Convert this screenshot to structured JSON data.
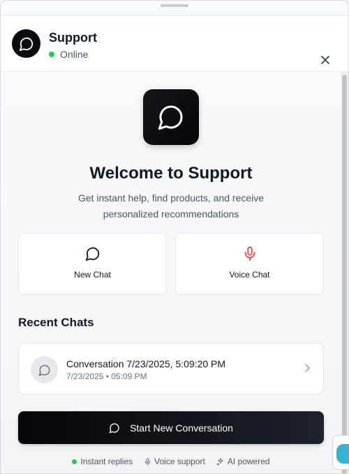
{
  "header": {
    "title": "Support",
    "status": "Online",
    "status_color": "#22c55e"
  },
  "hero": {
    "icon": "chat-bubble-icon",
    "title": "Welcome to Support",
    "subtitle": "Get instant help, find products, and receive personalized recommendations"
  },
  "actions": [
    {
      "label": "New Chat",
      "icon": "chat-bubble-icon",
      "color": "#111827"
    },
    {
      "label": "Voice Chat",
      "icon": "microphone-icon",
      "color": "#ef4444"
    }
  ],
  "recent": {
    "title": "Recent Chats",
    "items": [
      {
        "title": "Conversation 7/23/2025, 5:09:20 PM",
        "meta": "7/23/2025 • 05:09 PM"
      }
    ]
  },
  "cta": {
    "label": "Start New Conversation"
  },
  "footer": {
    "items": [
      {
        "label": "Instant replies",
        "icon": "green-dot"
      },
      {
        "label": "Voice support",
        "icon": "microphone-icon"
      },
      {
        "label": "AI powered",
        "icon": "sparkles-icon"
      }
    ]
  }
}
